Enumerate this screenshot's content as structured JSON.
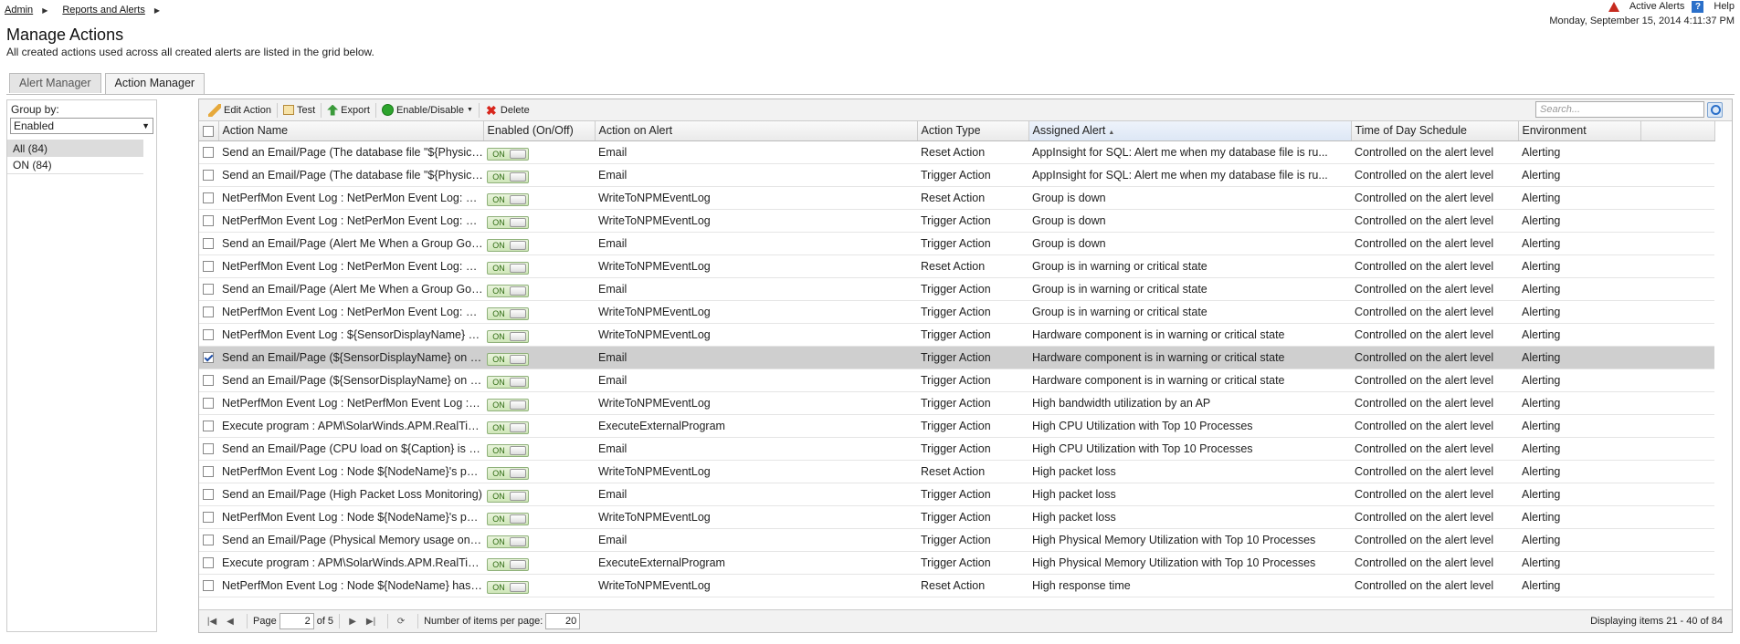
{
  "breadcrumb": [
    "Admin",
    "Reports and Alerts"
  ],
  "header": {
    "active_alerts": "Active Alerts",
    "help": "Help",
    "datetime": "Monday, September 15, 2014 4:11:37 PM"
  },
  "page": {
    "title": "Manage Actions",
    "subtitle": "All created actions used across all created alerts are listed in the grid below."
  },
  "tabs": [
    "Alert Manager",
    "Action Manager"
  ],
  "left_panel": {
    "group_by_label": "Group by:",
    "group_by_value": "Enabled",
    "groups": [
      "All (84)",
      "ON (84)"
    ]
  },
  "toolbar": {
    "edit": "Edit Action",
    "test": "Test",
    "export": "Export",
    "enable_disable": "Enable/Disable",
    "delete": "Delete",
    "search_placeholder": "Search..."
  },
  "columns": [
    "Action Name",
    "Enabled (On/Off)",
    "Action on Alert",
    "Action Type",
    "Assigned Alert",
    "Time of Day Schedule",
    "Environment"
  ],
  "toggle_label": "ON",
  "rows": [
    {
      "name": "Send an Email/Page (The database file \"${PhysicalNam...",
      "action": "Email",
      "type": "Reset Action",
      "alert": "AppInsight for SQL: Alert me when my database file is ru...",
      "schedule": "Controlled on the alert level",
      "env": "Alerting"
    },
    {
      "name": "Send an Email/Page (The database file \"${PhysicalNam...",
      "action": "Email",
      "type": "Trigger Action",
      "alert": "AppInsight for SQL: Alert me when my database file is ru...",
      "schedule": "Controlled on the alert level",
      "env": "Alerting"
    },
    {
      "name": "NetPerfMon Event Log : NetPerMon Event Log: Group ${...",
      "action": "WriteToNPMEventLog",
      "type": "Reset Action",
      "alert": "Group is down",
      "schedule": "Controlled on the alert level",
      "env": "Alerting"
    },
    {
      "name": "NetPerfMon Event Log : NetPerMon Event Log: Group ${...",
      "action": "WriteToNPMEventLog",
      "type": "Trigger Action",
      "alert": "Group is down",
      "schedule": "Controlled on the alert level",
      "env": "Alerting"
    },
    {
      "name": "Send an Email/Page (Alert Me When a Group Goes Down)",
      "action": "Email",
      "type": "Trigger Action",
      "alert": "Group is down",
      "schedule": "Controlled on the alert level",
      "env": "Alerting"
    },
    {
      "name": "NetPerfMon Event Log : NetPerMon Event Log: Group ${...",
      "action": "WriteToNPMEventLog",
      "type": "Reset Action",
      "alert": "Group is in warning or critical state",
      "schedule": "Controlled on the alert level",
      "env": "Alerting"
    },
    {
      "name": "Send an Email/Page (Alert Me When a Group Goes Into ...",
      "action": "Email",
      "type": "Trigger Action",
      "alert": "Group is in warning or critical state",
      "schedule": "Controlled on the alert level",
      "env": "Alerting"
    },
    {
      "name": "NetPerfMon Event Log : NetPerMon Event Log: Group ${...",
      "action": "WriteToNPMEventLog",
      "type": "Trigger Action",
      "alert": "Group is in warning or critical state",
      "schedule": "Controlled on the alert level",
      "env": "Alerting"
    },
    {
      "name": "NetPerfMon Event Log : ${SensorDisplayName} on ${No...",
      "action": "WriteToNPMEventLog",
      "type": "Trigger Action",
      "alert": "Hardware component is in warning or critical state",
      "schedule": "Controlled on the alert level",
      "env": "Alerting"
    },
    {
      "name": "Send an Email/Page (${SensorDisplayName} on ${Node...",
      "action": "Email",
      "type": "Trigger Action",
      "alert": "Hardware component is in warning or critical state",
      "schedule": "Controlled on the alert level",
      "env": "Alerting",
      "selected": true
    },
    {
      "name": "Send an Email/Page (${SensorDisplayName} on ${Node...",
      "action": "Email",
      "type": "Trigger Action",
      "alert": "Hardware component is in warning or critical state",
      "schedule": "Controlled on the alert level",
      "env": "Alerting"
    },
    {
      "name": "NetPerfMon Event Log : NetPerfMon Event Log : Wireles...",
      "action": "WriteToNPMEventLog",
      "type": "Trigger Action",
      "alert": "High bandwidth utilization by an AP",
      "schedule": "Controlled on the alert level",
      "env": "Alerting"
    },
    {
      "name": "Execute program : APM\\SolarWinds.APM.RealTimeProc...",
      "action": "ExecuteExternalProgram",
      "type": "Trigger Action",
      "alert": "High CPU Utilization with Top 10 Processes",
      "schedule": "Controlled on the alert level",
      "env": "Alerting"
    },
    {
      "name": "Send an Email/Page (CPU load on ${Caption} is currentl...",
      "action": "Email",
      "type": "Trigger Action",
      "alert": "High CPU Utilization with Top 10 Processes",
      "schedule": "Controlled on the alert level",
      "env": "Alerting"
    },
    {
      "name": "NetPerfMon Event Log : Node ${NodeName}'s packet lo...",
      "action": "WriteToNPMEventLog",
      "type": "Reset Action",
      "alert": "High packet loss",
      "schedule": "Controlled on the alert level",
      "env": "Alerting"
    },
    {
      "name": "Send an Email/Page (High Packet Loss Monitoring)",
      "action": "Email",
      "type": "Trigger Action",
      "alert": "High packet loss",
      "schedule": "Controlled on the alert level",
      "env": "Alerting"
    },
    {
      "name": "NetPerfMon Event Log : Node ${NodeName}'s packet lo...",
      "action": "WriteToNPMEventLog",
      "type": "Trigger Action",
      "alert": "High packet loss",
      "schedule": "Controlled on the alert level",
      "env": "Alerting"
    },
    {
      "name": "Send an Email/Page (Physical Memory usage on ${Capti...",
      "action": "Email",
      "type": "Trigger Action",
      "alert": "High Physical Memory Utilization with Top 10 Processes",
      "schedule": "Controlled on the alert level",
      "env": "Alerting"
    },
    {
      "name": "Execute program : APM\\SolarWinds.APM.RealTimeProc...",
      "action": "ExecuteExternalProgram",
      "type": "Trigger Action",
      "alert": "High Physical Memory Utilization with Top 10 Processes",
      "schedule": "Controlled on the alert level",
      "env": "Alerting"
    },
    {
      "name": "NetPerfMon Event Log : Node ${NodeName} has droppe...",
      "action": "WriteToNPMEventLog",
      "type": "Reset Action",
      "alert": "High response time",
      "schedule": "Controlled on the alert level",
      "env": "Alerting"
    }
  ],
  "pager": {
    "page_label": "Page",
    "page_value": "2",
    "of_label": "of 5",
    "per_page_label": "Number of items per page:",
    "per_page_value": "20",
    "display_info": "Displaying items 21 - 40 of 84"
  },
  "colors": {
    "selected_row": "#cfcfcf",
    "toggle_on": "#cfe6b8",
    "delete_icon": "#d8261c"
  }
}
